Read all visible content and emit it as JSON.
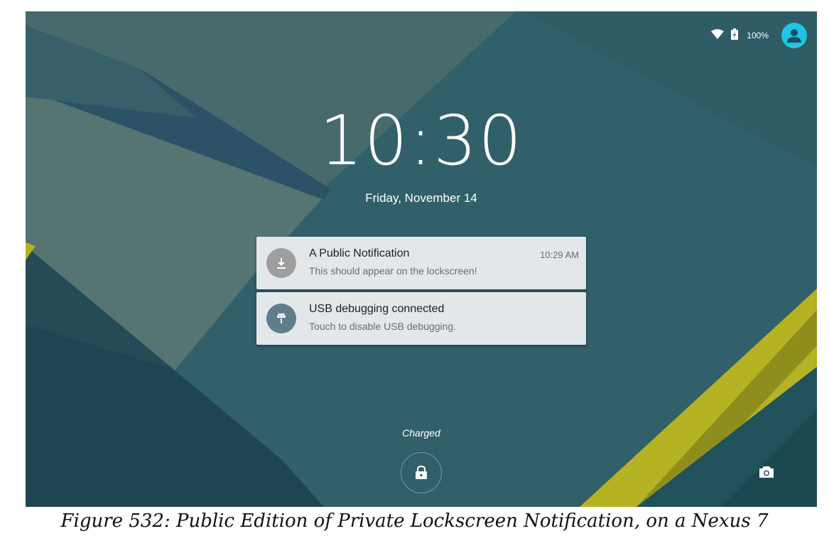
{
  "status_bar": {
    "battery_percent": "100%",
    "icons": [
      "wifi-icon",
      "battery-charging-icon",
      "user-avatar-icon"
    ]
  },
  "lockscreen": {
    "time": "10:30",
    "date": "Friday, November 14",
    "charging_status": "Charged"
  },
  "notifications": [
    {
      "title": "A Public Notification",
      "text": "This should appear on the lockscreen!",
      "time": "10:29 AM",
      "icon": "download-icon",
      "icon_color": "#9e9e9e"
    },
    {
      "title": "USB debugging connected",
      "text": "Touch to disable USB debugging.",
      "time": "",
      "icon": "android-icon",
      "icon_color": "#607d8b"
    }
  ],
  "bottom_actions": [
    "lock-icon",
    "camera-icon"
  ],
  "caption": "Figure 532: Public Edition of Private Lockscreen Notification, on a Nexus 7",
  "colors": {
    "wallpaper_base": "#2f5962",
    "accent_yellow": "#b5b223",
    "avatar": "#20c4e6"
  }
}
